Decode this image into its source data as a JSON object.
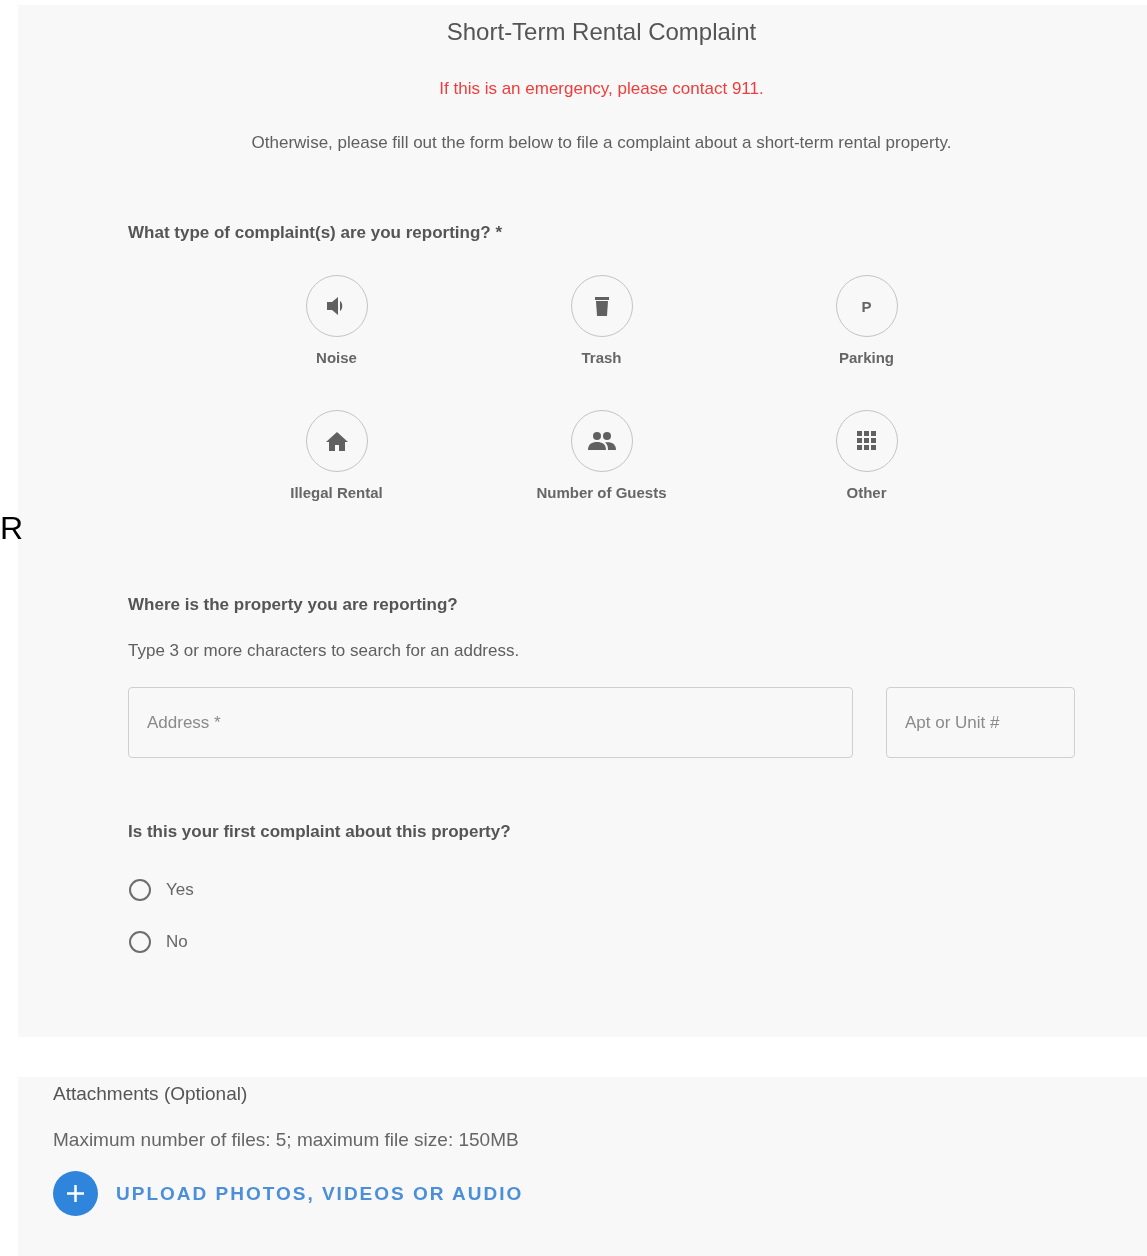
{
  "edge_text": "R",
  "form": {
    "title": "Short-Term Rental Complaint",
    "emergency_notice": "If this is an emergency, please contact 911.",
    "intro": "Otherwise, please fill out the form below to file a complaint about a short-term rental property.",
    "complaint_question": "What type of complaint(s) are you reporting? *",
    "complaint_types": [
      {
        "kind": "speaker",
        "label": "Noise",
        "selected": false
      },
      {
        "kind": "trash",
        "label": "Trash",
        "selected": false
      },
      {
        "kind": "parking",
        "label": "Parking",
        "icon_text": "P",
        "selected": false
      },
      {
        "kind": "house",
        "label": "Illegal Rental",
        "selected": false
      },
      {
        "kind": "people",
        "label": "Number of Guests",
        "selected": false
      },
      {
        "kind": "grid",
        "label": "Other",
        "selected": false
      }
    ],
    "location_question": "Where is the property you are reporting?",
    "location_hint": "Type 3 or more characters to search for an address.",
    "address_field": {
      "placeholder": "Address *"
    },
    "unit_field": {
      "placeholder": "Apt or Unit #"
    },
    "first_complaint_question": "Is this your first complaint about this property?",
    "first_complaint_options": [
      {
        "label": "Yes",
        "selected": false
      },
      {
        "label": "No",
        "selected": false
      }
    ]
  },
  "attachments": {
    "title": "Attachments (Optional)",
    "limits": "Maximum number of files: 5; maximum file size: 150MB",
    "upload_button": "UPLOAD PHOTOS, VIDEOS OR AUDIO"
  }
}
